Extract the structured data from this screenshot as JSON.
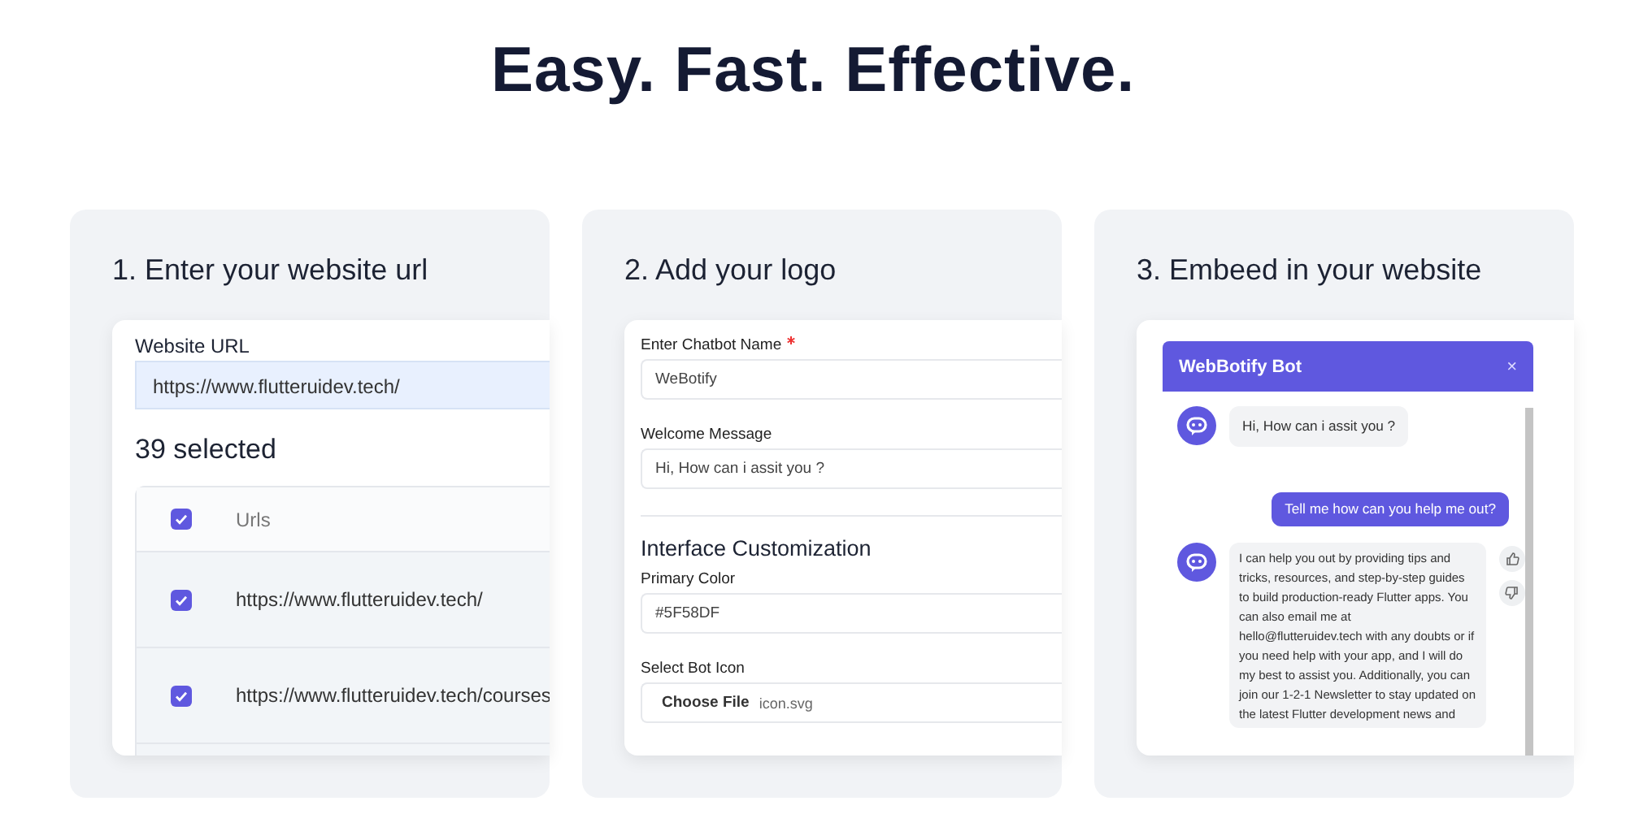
{
  "heading": "Easy. Fast. Effective.",
  "steps": [
    {
      "kind": "urls",
      "title": "1. Enter your website url",
      "field_label": "Website URL",
      "url_value": "https://www.flutteruidev.tech/",
      "selected_count": "39 selected",
      "header": {
        "label": "Urls",
        "checked": true
      },
      "rows": [
        {
          "url": "https://www.flutteruidev.tech/",
          "checked": true
        },
        {
          "url": "https://www.flutteruidev.tech/courses",
          "checked": true
        }
      ]
    },
    {
      "kind": "form",
      "title": "2. Add your logo",
      "items": [
        {
          "kind": "field",
          "label": "Enter Chatbot Name",
          "required": true,
          "value": "WeBotify"
        },
        {
          "kind": "field",
          "label": "Welcome Message",
          "required": false,
          "value": "Hi, How can i assit you ?"
        },
        {
          "kind": "section",
          "text": "Interface Customization"
        },
        {
          "kind": "field",
          "label": "Primary Color",
          "required": false,
          "value": "#5F58DF"
        },
        {
          "kind": "file",
          "label": "Select Bot Icon",
          "button": "Choose File",
          "file_name": "icon.svg"
        }
      ]
    },
    {
      "kind": "chat",
      "title": "3. Embeed in your website",
      "bot_name": "WebBotify Bot",
      "close": "×",
      "messages": [
        {
          "kind": "bot",
          "text": "Hi, How can i assit you ?",
          "feedback": false
        },
        {
          "kind": "user",
          "text": "Tell me how can you help me out?",
          "feedback": false
        },
        {
          "kind": "bot",
          "text": "I can help you out by providing tips and tricks, resources, and step-by-step guides to build production-ready Flutter apps. You can also email me at hello@flutteruidev.tech with any doubts or if you need help with your app, and I will do my best to assist you. Additionally, you can join our 1-2-1 Newsletter to stay updated on the latest Flutter development news and",
          "feedback": true
        }
      ]
    }
  ]
}
